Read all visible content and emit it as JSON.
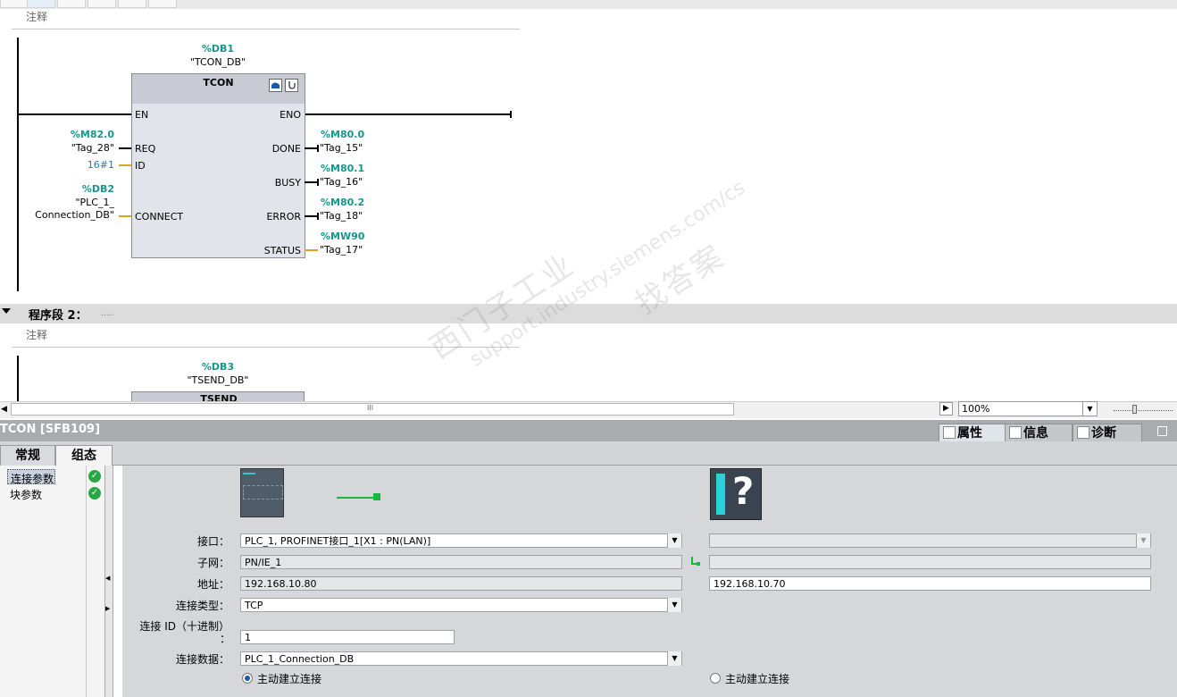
{
  "network1": {
    "comment": "注释",
    "instance_operand": "%DB1",
    "instance_name": "\"TCON_DB\"",
    "block_name": "TCON",
    "inputs": {
      "en": "EN",
      "req": "REQ",
      "id": "ID",
      "connect": "CONNECT"
    },
    "outputs": {
      "eno": "ENO",
      "done": "DONE",
      "busy": "BUSY",
      "error": "ERROR",
      "status": "STATUS"
    },
    "req_operand": "%M82.0",
    "req_tag": "\"Tag_28\"",
    "id_value": "16#1",
    "connect_operand": "%DB2",
    "connect_tag_line1": "\"PLC_1_",
    "connect_tag_line2": "Connection_DB\"",
    "done_operand": "%M80.0",
    "done_tag": "\"Tag_15\"",
    "busy_operand": "%M80.1",
    "busy_tag": "\"Tag_16\"",
    "error_operand": "%M80.2",
    "error_tag": "\"Tag_18\"",
    "status_operand": "%MW90",
    "status_tag": "\"Tag_17\""
  },
  "network2": {
    "title": "程序段 2：",
    "dots": ".....",
    "comment": "注释",
    "instance_operand": "%DB3",
    "instance_name": "\"TSEND_DB\"",
    "block_name": "TSEND"
  },
  "scrollbar": {
    "grip": "III",
    "zoom_value": "100%"
  },
  "inspector": {
    "title": "TCON [SFB109]",
    "tabs_left": [
      "常规",
      "组态"
    ],
    "tabs_right": [
      "属性",
      "信息",
      "诊断"
    ],
    "nav_items": [
      "连接参数",
      "块参数"
    ],
    "interface_label": "接口：",
    "interface_value": "PLC_1, PROFINET接口_1[X1 : PN(LAN)]",
    "subnet_label": "子网：",
    "subnet_value": "PN/IE_1",
    "address_label": "地址：",
    "address_value": "192.168.10.80",
    "partner_address_value": "192.168.10.70",
    "conn_type_label": "连接类型：",
    "conn_type_value": "TCP",
    "conn_id_label": "连接 ID（十进制）",
    "conn_id_colon": "：",
    "conn_id_value": "1",
    "conn_data_label": "连接数据：",
    "conn_data_value": "PLC_1_Connection_DB",
    "radio_local": "主动建立连接",
    "radio_partner": "主动建立连接",
    "partner_unknown_glyph": "?"
  },
  "watermark": {
    "line1": "西门子工业",
    "line2": "找答案",
    "line3": "support.industry.siemens.com/cs"
  },
  "colors": {
    "operand": "#16958e",
    "orange_wire": "#e0a020",
    "ok_green": "#27a845"
  }
}
